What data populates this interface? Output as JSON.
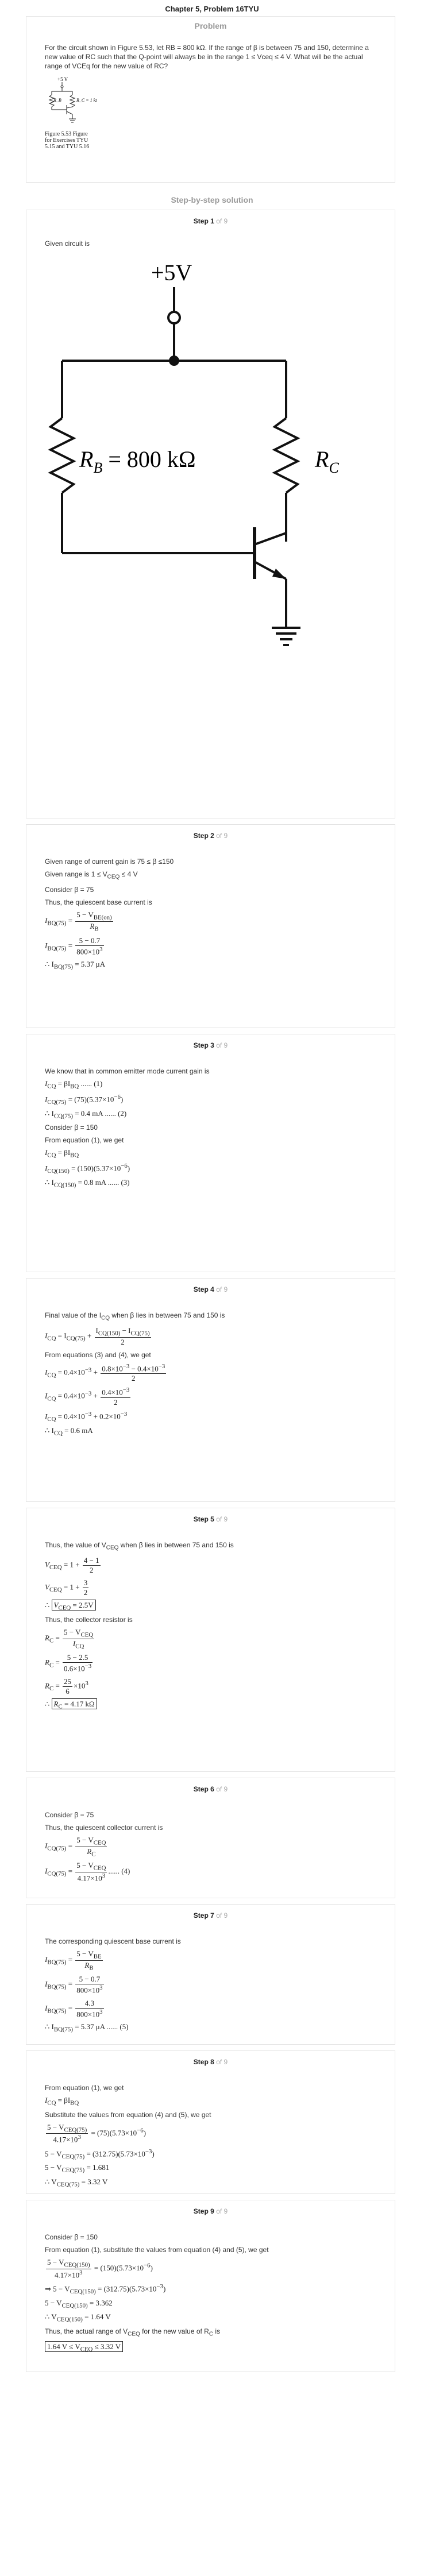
{
  "page_title": "Chapter 5, Problem 16TYU",
  "problem_heading": "Problem",
  "problem_text": "For the circuit shown in Figure 5.53, let RB = 800 kΩ. If the range of β is between 75 and 150, determine a new value of RC such that the Q-point will always be in the range 1 ≤ Vceq ≤ 4 V. What will be the actual range of VCEq for the new value of RC?",
  "fig_small": {
    "vcc": "+5 V",
    "rb": "R_B",
    "rc": "R_C = 1 kΩ"
  },
  "fig_caption": "Figure 5.53 Figure for Exercises TYU 5.15 and TYU 5.16",
  "solution_heading": "Step-by-step solution",
  "step_word": "Step",
  "of_total": "of 9",
  "steps": [
    {
      "n": "1",
      "given": "Given circuit is",
      "vcc": "+5V",
      "rb": "R",
      "rb_sub": "B",
      "rb_val": " = 800 kΩ",
      "rc": "R",
      "rc_sub": "C"
    },
    {
      "n": "2",
      "l1": "Given range of current gain is  75 ≤ β ≤150",
      "l2": "Given range is  1 ≤ V",
      "l2s": "CEQ",
      "l2e": " ≤ 4 V",
      "l3": "Consider  β = 75",
      "l4": "Thus, the quiescent base current is",
      "e1l": "I",
      "e1ls": "BQ(75)",
      "e1n": "5 − V",
      "e1ns": "BE(on)",
      "e1d": "R",
      "e1ds": "B",
      "e2n": "5 − 0.7",
      "e2d": "800×10",
      "e2dp": "3",
      "res_pre": "∴ I",
      "res_sub": "BQ(75)",
      "res_val": " = 5.37 μA"
    },
    {
      "n": "3",
      "l1": "We know that in common emitter mode current gain is",
      "e1": "I",
      "e1s": "CQ",
      "e1r": " = βI",
      "e1rs": "BQ",
      "e1t": " ...... (1)",
      "e2": "I",
      "e2s": "CQ(75)",
      "e2r": " = (75)(5.37×10",
      "e2p": "−6",
      "e2e": ")",
      "e3": "∴ I",
      "e3s": "CQ(75)",
      "e3r": " = 0.4 mA ...... (2)",
      "l2": "Consider  β = 150",
      "l3": "From equation (1), we get",
      "e4": "I",
      "e4s": "CQ",
      "e4r": " = βI",
      "e4rs": "BQ",
      "e5": "I",
      "e5s": "CQ(150)",
      "e5r": " = (150)(5.37×10",
      "e5p": "−6",
      "e5e": ")",
      "e6": "∴ I",
      "e6s": "CQ(150)",
      "e6r": " = 0.8 mA ...... (3)"
    },
    {
      "n": "4",
      "l1a": "Final value of the  I",
      "l1s": "CQ",
      "l1b": " when  β lies in between 75 and 150 is",
      "e1": "I",
      "e1s": "CQ",
      "e1m": " = I",
      "e1ms": "CQ(75)",
      "e1fn": "I",
      "e1fns": "CQ(150)",
      "e1fnm": " − I",
      "e1fns2": "CQ(75)",
      "e1fd": "2",
      "l2": "From equations (3) and (4), we get",
      "e2a": "I",
      "e2as": "CQ",
      "e2b": " = 0.4×10",
      "e2bp": "−3",
      "e2n": "0.8×10",
      "e2np": "−3",
      "e2nm": " − 0.4×10",
      "e2np2": "−3",
      "e2d": "2",
      "e3n": "0.4×10",
      "e3np": "−3",
      "e4b": " + 0.2×10",
      "e4bp": "−3",
      "e5": "∴ I",
      "e5s": "CQ",
      "e5r": " = 0.6 mA"
    },
    {
      "n": "5",
      "l1a": "Thus, the value of  V",
      "l1s": "CEQ",
      "l1b": "  when  β lies in between 75 and 150 is",
      "e1": "V",
      "e1s": "CEQ",
      "e1m": " = 1 + ",
      "e1n": "4 − 1",
      "e1d": "2",
      "e2n": "3",
      "e2d": "2",
      "e3": "∴ ",
      "e3v": "V",
      "e3vs": "CEQ",
      "e3r": " = 2.5V",
      "l2": "Thus, the collector resistor is",
      "e4": "R",
      "e4s": "C",
      "e4n": "5 − V",
      "e4ns": "CEQ",
      "e4d": "I",
      "e4ds": "CQ",
      "e5n": "5 − 2.5",
      "e5d": "0.6×10",
      "e5dp": "−3",
      "e6n": "25",
      "e6d": "6",
      "e6x": "×10",
      "e6xp": "3",
      "e7": "∴ ",
      "e7v": "R",
      "e7vs": "C",
      "e7r": " = 4.17 kΩ"
    },
    {
      "n": "6",
      "l1": "Consider  β = 75",
      "l2": "Thus, the quiescent collector current is",
      "e1": "I",
      "e1s": "CQ(75)",
      "e1n": "5 − V",
      "e1ns": "CEQ",
      "e1d": "R",
      "e1ds": "C",
      "e2n": "5 − V",
      "e2ns": "CEQ",
      "e2d": "4.17×10",
      "e2dp": "3",
      "e2t": "...... (4)"
    },
    {
      "n": "7",
      "l1": "The corresponding quiescent base current is",
      "e1": "I",
      "e1s": "BQ(75)",
      "e1n": "5 − V",
      "e1ns": "BE",
      "e1d": "R",
      "e1ds": "B",
      "e2n": "5 − 0.7",
      "e2d": "800×10",
      "e2dp": "3",
      "e3n": "4.3",
      "e3d": "800×10",
      "e3dp": "3",
      "e4": "∴ I",
      "e4s": "BQ(75)",
      "e4r": " = 5.37 μA ...... (5)"
    },
    {
      "n": "8",
      "l1": "From equation (1), we get",
      "e1": "I",
      "e1s": "CQ",
      "e1r": " = βI",
      "e1rs": "BQ",
      "l2": "Substitute the values from equation (4) and (5), we get",
      "e2n": "5 − V",
      "e2ns": "CEQ(75)",
      "e2d": "4.17×10",
      "e2dp": "3",
      "e2r": " = (75)(5.73×10",
      "e2rp": "−6",
      "e2re": ")",
      "e3": "5 − V",
      "e3s": "CEQ(75)",
      "e3r": " = (312.75)(5.73×10",
      "e3rp": "−3",
      "e3re": ")",
      "e4": "5 − V",
      "e4s": "CEQ(75)",
      "e4r": " = 1.681",
      "e5": "∴ V",
      "e5s": "CEQ(75)",
      "e5r": " = 3.32 V"
    },
    {
      "n": "9",
      "l1": "Consider  β = 150",
      "l2": "From equation (1), substitute the values from equation (4) and (5), we get",
      "e1n": "5 − V",
      "e1ns": "CEQ(150)",
      "e1d": "4.17×10",
      "e1dp": "3",
      "e1r": " = (150)(5.73×10",
      "e1rp": "−6",
      "e1re": ")",
      "e2": "⇒ 5 − V",
      "e2s": "CEQ(150)",
      "e2r": " = (312.75)(5.73×10",
      "e2rp": "−3",
      "e2re": ")",
      "e3": "5 − V",
      "e3s": "CEQ(150)",
      "e3r": " = 3.362",
      "e4": "∴ V",
      "e4s": "CEQ(150)",
      "e4r": " = 1.64 V",
      "l3a": "Thus, the actual range of  V",
      "l3s": "CEQ",
      "l3b": "  for the new value of  R",
      "l3s2": "C",
      "l3c": "  is",
      "fin1": "1.64 V ≤ V",
      "fins": "CEQ",
      "fin2": " ≤ 3.32 V"
    }
  ]
}
